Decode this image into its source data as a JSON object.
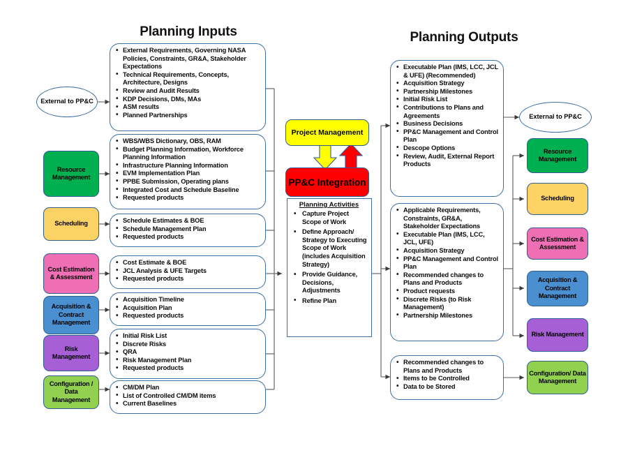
{
  "headings": {
    "inputs": "Planning Inputs",
    "outputs": "Planning Outputs"
  },
  "center": {
    "project_management": "Project Management",
    "ppc_integration": "PP&C Integration",
    "activities_title": "Planning Activities",
    "activities": [
      "Capture Project Scope of Work",
      "Define Approach/ Strategy to Executing Scope of Work (includes Acquisition Strategy)",
      "Provide Guidance, Decisions, Adjustments",
      "Refine Plan"
    ]
  },
  "left_nodes": [
    {
      "id": "external-to-ppc",
      "label": "External to PP&C",
      "shape": "ellipse",
      "color": "#FFFFFF"
    },
    {
      "id": "resource-management",
      "label": "Resource Management",
      "shape": "box",
      "color": "#00B050"
    },
    {
      "id": "scheduling",
      "label": "Scheduling",
      "shape": "box",
      "color": "#FCD265"
    },
    {
      "id": "cost-estimation-assessment",
      "label": "Cost Estimation & Assessment",
      "shape": "box",
      "color": "#EE6FB4"
    },
    {
      "id": "acquisition-contract-management",
      "label": "Acquisition & Contract Management",
      "shape": "box",
      "color": "#4A90D0"
    },
    {
      "id": "risk-management",
      "label": "Risk Management",
      "shape": "box",
      "color": "#A65FD4"
    },
    {
      "id": "configuration-data-management",
      "label": "Configuration / Data Management",
      "shape": "box",
      "color": "#92D050"
    }
  ],
  "right_nodes": [
    {
      "id": "external-to-ppc-out",
      "label": "External to PP&C",
      "shape": "ellipse",
      "color": "#FFFFFF"
    },
    {
      "id": "resource-management-out",
      "label": "Resource Management",
      "shape": "box",
      "color": "#00B050"
    },
    {
      "id": "scheduling-out",
      "label": "Scheduling",
      "shape": "box",
      "color": "#FCD265"
    },
    {
      "id": "cost-estimation-assessment-out",
      "label": "Cost Estimation & Assessment",
      "shape": "box",
      "color": "#EE6FB4"
    },
    {
      "id": "acquisition-contract-management-out",
      "label": "Acquisition & Contract Management",
      "shape": "box",
      "color": "#4A90D0"
    },
    {
      "id": "risk-management-out",
      "label": "Risk Management",
      "shape": "box",
      "color": "#A65FD4"
    },
    {
      "id": "configuration-data-management-out",
      "label": "Configuration/ Data Management",
      "shape": "box",
      "color": "#92D050"
    }
  ],
  "input_lists": [
    {
      "id": "input-external",
      "items": [
        "External Requirements, Governing NASA Policies, Constraints, GR&A, Stakeholder Expectations",
        "Technical Requirements, Concepts, Architecture, Designs",
        "Review and Audit Results",
        "KDP Decisions, DMs, MAs",
        "ASM results",
        "Planned Partnerships"
      ]
    },
    {
      "id": "input-resource-management",
      "items": [
        "WBS/WBS Dictionary, OBS, RAM",
        "Budget Planning Information, Workforce Planning Information",
        "Infrastructure Planning Information",
        "EVM Implementation Plan",
        "PPBE Submission, Operating plans",
        "Integrated Cost and Schedule Baseline",
        "Requested products"
      ]
    },
    {
      "id": "input-scheduling",
      "items": [
        "Schedule Estimates & BOE",
        "Schedule Management Plan",
        "Requested products"
      ]
    },
    {
      "id": "input-cost-estimation",
      "items": [
        "Cost Estimate & BOE",
        "JCL Analysis & UFE Targets",
        "Requested products"
      ]
    },
    {
      "id": "input-acquisition",
      "items": [
        "Acquisition Timeline",
        "Acquisition Plan",
        "Requested products"
      ]
    },
    {
      "id": "input-risk",
      "items": [
        "Initial Risk List",
        "Discrete Risks",
        "QRA",
        "Risk Management Plan",
        "Requested products"
      ]
    },
    {
      "id": "input-configuration",
      "items": [
        "CM/DM Plan",
        "List of Controlled CM/DM items",
        "Current Baselines"
      ]
    }
  ],
  "output_lists": [
    {
      "id": "output-external",
      "items": [
        "Executable Plan (IMS, LCC, JCL & UFE) (Recommended)",
        "Acquisition Strategy",
        "Partnership Milestones",
        "Initial Risk List",
        "Contributions to Plans and Agreements",
        "Business Decisions",
        "PP&C Management and Control Plan",
        "Descope Options",
        "Review, Audit, External Report Products"
      ]
    },
    {
      "id": "output-disciplines",
      "items": [
        "Applicable Requirements, Constraints, GR&A, Stakeholder Expectations",
        "Executable Plan (IMS, LCC, JCL, UFE)",
        "Acquisition Strategy",
        "PP&C Management and Control Plan",
        "Recommended changes to Plans and Products",
        "Product requests",
        "Discrete Risks (to Risk Management)",
        "Partnership Milestones"
      ]
    },
    {
      "id": "output-configuration",
      "items": [
        "Recommended changes to Plans and Products",
        "Items to be Controlled",
        "Data to be Stored"
      ]
    }
  ],
  "colors": {
    "outline_blue": "#3b6ea5",
    "wire_gray": "#595959",
    "yellow": "#FFFF00",
    "red": "#FF0000"
  }
}
